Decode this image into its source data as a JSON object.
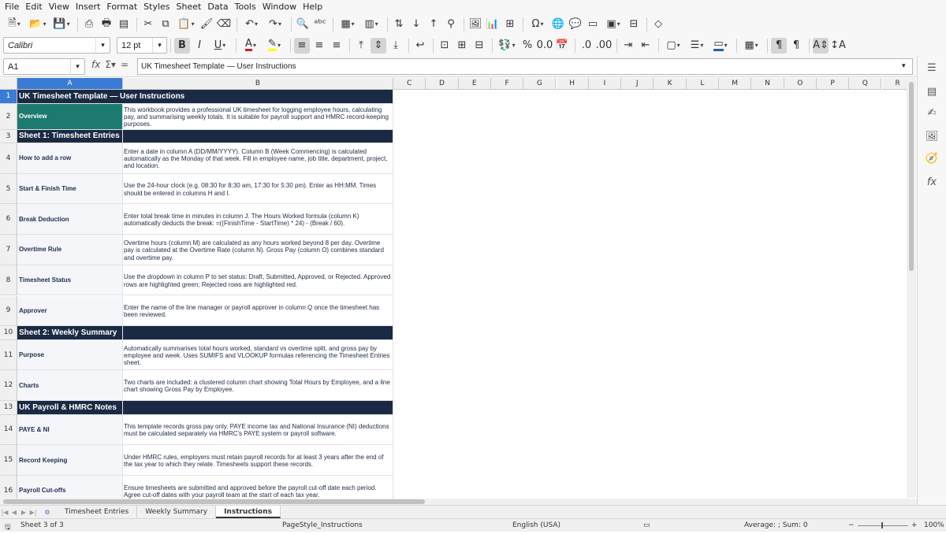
{
  "menu": [
    "File",
    "Edit",
    "View",
    "Insert",
    "Format",
    "Styles",
    "Sheet",
    "Data",
    "Tools",
    "Window",
    "Help"
  ],
  "font_name": "Calibri",
  "font_size": "12 pt",
  "name_box": "A1",
  "formula": "UK Timesheet Template — User Instructions",
  "columns": [
    "A",
    "B",
    "C",
    "D",
    "E",
    "F",
    "G",
    "H",
    "I",
    "J",
    "K",
    "L",
    "M",
    "N",
    "O",
    "P",
    "Q",
    "R"
  ],
  "rows": [
    {
      "num": "1",
      "a": "UK Timesheet Template — User Instructions",
      "b": "",
      "kind": "title"
    },
    {
      "num": "2",
      "a": "Overview",
      "b": "This workbook provides a professional UK timesheet for logging employee hours, calculating pay, and summarising weekly totals. It is suitable for payroll support and HMRC record-keeping purposes.",
      "kind": "teal"
    },
    {
      "num": "3",
      "a": "Sheet 1: Timesheet Entries",
      "b": "",
      "kind": "section"
    },
    {
      "num": "4",
      "a": "How to add a row",
      "b": "Enter a date in column A (DD/MM/YYYY). Column B (Week Commencing) is calculated automatically as the Monday of that week. Fill in employee name, job title, department, project, and location.",
      "kind": "row"
    },
    {
      "num": "5",
      "a": "Start & Finish Time",
      "b": "Use the 24-hour clock (e.g. 08:30 for 8:30 am, 17:30 for 5:30 pm). Enter as HH:MM. Times should be entered in columns H and I.",
      "kind": "row"
    },
    {
      "num": "6",
      "a": "Break Deduction",
      "b": "Enter total break time in minutes in column J. The Hours Worked formula (column K) automatically deducts the break: =((FinishTime - StartTime) * 24) - (Break / 60).",
      "kind": "row"
    },
    {
      "num": "7",
      "a": "Overtime Rule",
      "b": "Overtime hours (column M) are calculated as any hours worked beyond 8 per day. Overtime pay is calculated at the Overtime Rate (column N). Gross Pay (column O) combines standard and overtime pay.",
      "kind": "row"
    },
    {
      "num": "8",
      "a": "Timesheet Status",
      "b": "Use the dropdown in column P to set status: Draft, Submitted, Approved, or Rejected. Approved rows are highlighted green; Rejected rows are highlighted red.",
      "kind": "row"
    },
    {
      "num": "9",
      "a": "Approver",
      "b": "Enter the name of the line manager or payroll approver in column Q once the timesheet has been reviewed.",
      "kind": "row"
    },
    {
      "num": "10",
      "a": "Sheet 2: Weekly Summary",
      "b": "",
      "kind": "section"
    },
    {
      "num": "11",
      "a": "Purpose",
      "b": "Automatically summarises total hours worked, standard vs overtime split, and gross pay by employee and week. Uses SUMIFS and VLOOKUP formulas referencing the Timesheet Entries sheet.",
      "kind": "row"
    },
    {
      "num": "12",
      "a": "Charts",
      "b": "Two charts are included: a clustered column chart showing Total Hours by Employee, and a line chart showing Gross Pay by Employee.",
      "kind": "row"
    },
    {
      "num": "13",
      "a": "UK Payroll & HMRC Notes",
      "b": "",
      "kind": "section"
    },
    {
      "num": "14",
      "a": "PAYE & NI",
      "b": "This template records gross pay only. PAYE income tax and National Insurance (NI) deductions must be calculated separately via HMRC's PAYE system or payroll software.",
      "kind": "row"
    },
    {
      "num": "15",
      "a": "Record Keeping",
      "b": "Under HMRC rules, employers must retain payroll records for at least 3 years after the end of the tax year to which they relate. Timesheets support these records.",
      "kind": "row"
    },
    {
      "num": "16",
      "a": "Payroll Cut-offs",
      "b": "Ensure timesheets are submitted and approved before the payroll cut-off date each period. Agree cut-off dates with your payroll team at the start of each tax year.",
      "kind": "row"
    }
  ],
  "tabs": [
    "Timesheet Entries",
    "Weekly Summary",
    "Instructions"
  ],
  "active_tab": "Instructions",
  "status": {
    "sheet": "Sheet 3 of 3",
    "page_style": "PageStyle_Instructions",
    "language": "English (USA)",
    "summary": "Average: ; Sum: 0",
    "zoom": "100%"
  },
  "colors": {
    "section": "#1b2a44",
    "teal": "#1c7a70",
    "selection": "#3a7bd5"
  }
}
